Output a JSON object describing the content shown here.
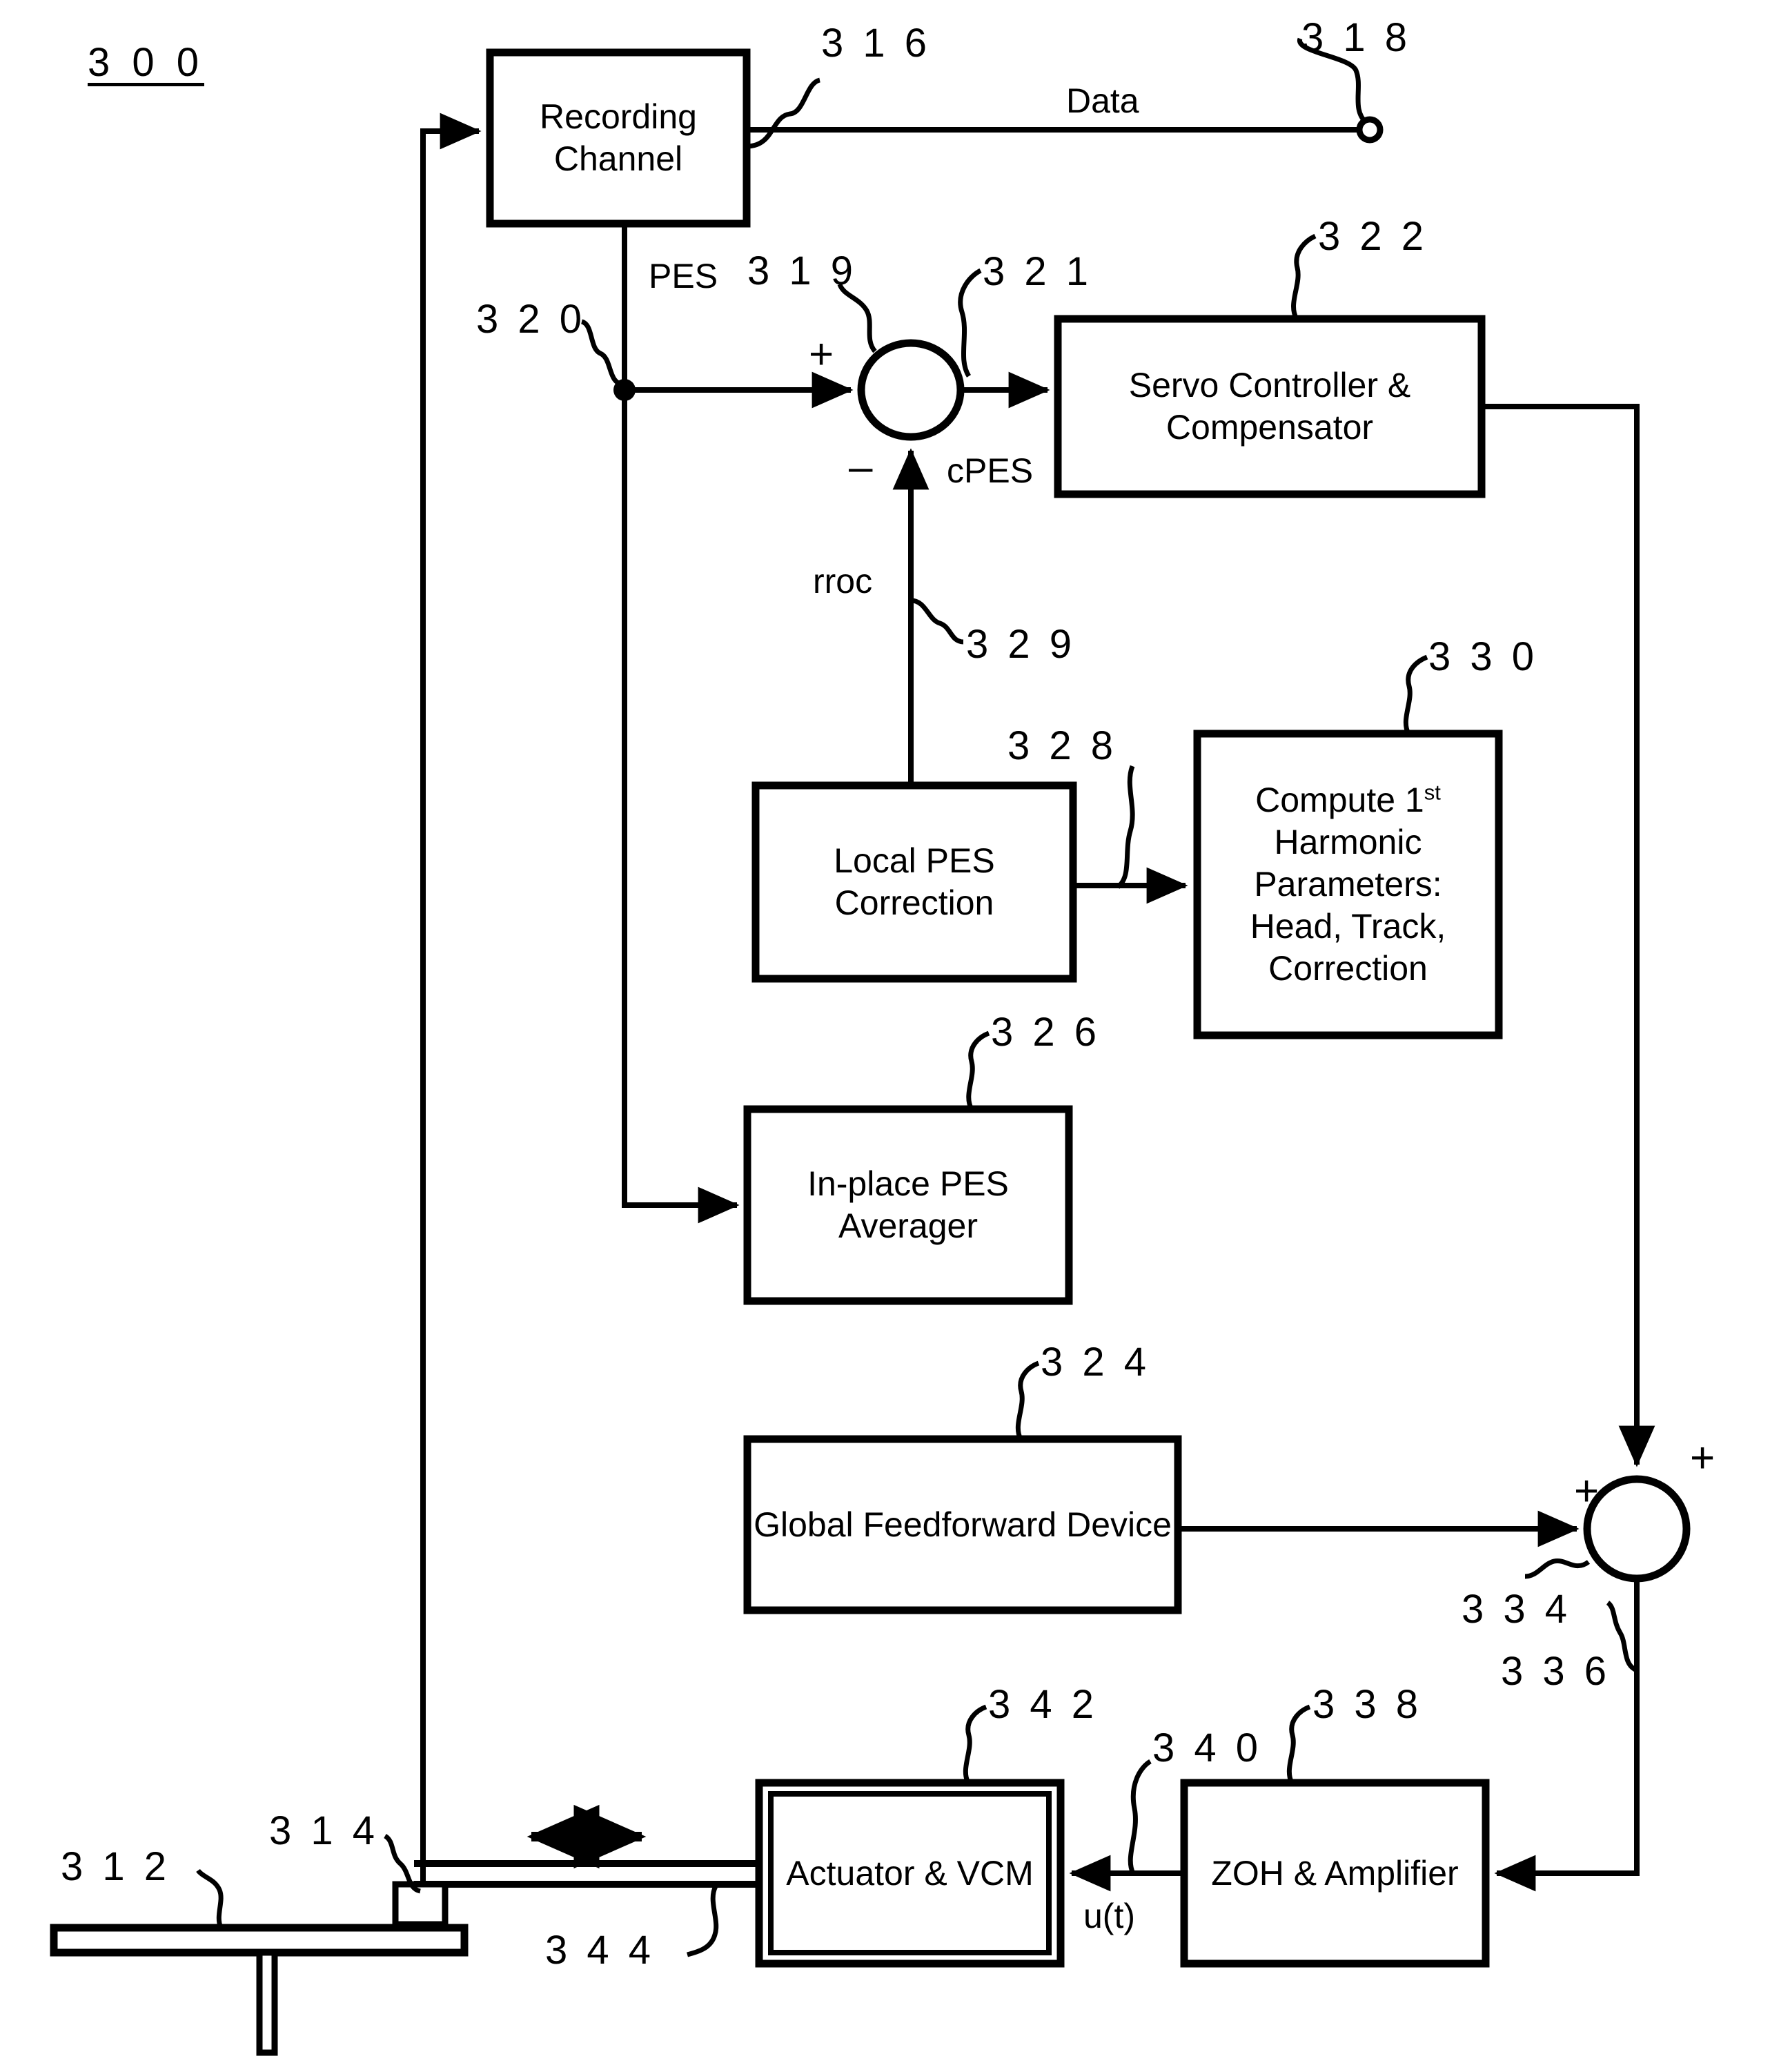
{
  "figure": {
    "number": "3 0 0"
  },
  "blocks": {
    "recording_channel": {
      "label": "Recording\nChannel",
      "ref": "3 1 6"
    },
    "servo_controller": {
      "label": "Servo Controller &\nCompensator",
      "ref": "3 2 2"
    },
    "compute_harmonic": {
      "label_line1": "Compute 1",
      "label_sup": "st",
      "label_rest": "Harmonic\nParameters:\nHead, Track,\nCorrection",
      "ref": "3 3 0"
    },
    "local_pes_correction": {
      "label": "Local PES\nCorrection",
      "ref": "3 2 8"
    },
    "in_place_pes_averager": {
      "label": "In-place PES\nAverager",
      "ref": "3 2 6"
    },
    "global_feedforward": {
      "label": "Global Feedforward\nDevice",
      "ref": "3 2 4"
    },
    "actuator_vcm": {
      "label": "Actuator\n& VCM",
      "ref": "3 4 2"
    },
    "zoh_amplifier": {
      "label": "ZOH &\nAmplifier",
      "ref": "3 3 8"
    }
  },
  "signals": {
    "data": "Data",
    "data_ref": "3 1 8",
    "pes": "PES",
    "pes_ref": "3 1 9",
    "pes_line_ref": "3 2 0",
    "cpes": "cPES",
    "cpes_ref": "3 2 1",
    "rroc": "rroc",
    "rroc_ref": "3 2 9",
    "sum2_ref": "3 3 4",
    "sum2_out_ref": "3 3 6",
    "ut": "u(t)",
    "ut_ref": "3 4 0",
    "actuator_arm_ref": "3 4 4",
    "disk_ref": "3 1 2",
    "head_ref": "3 1 4",
    "plus": "+",
    "minus": "–"
  },
  "colors": {
    "line": "#000000",
    "background": "#ffffff"
  }
}
